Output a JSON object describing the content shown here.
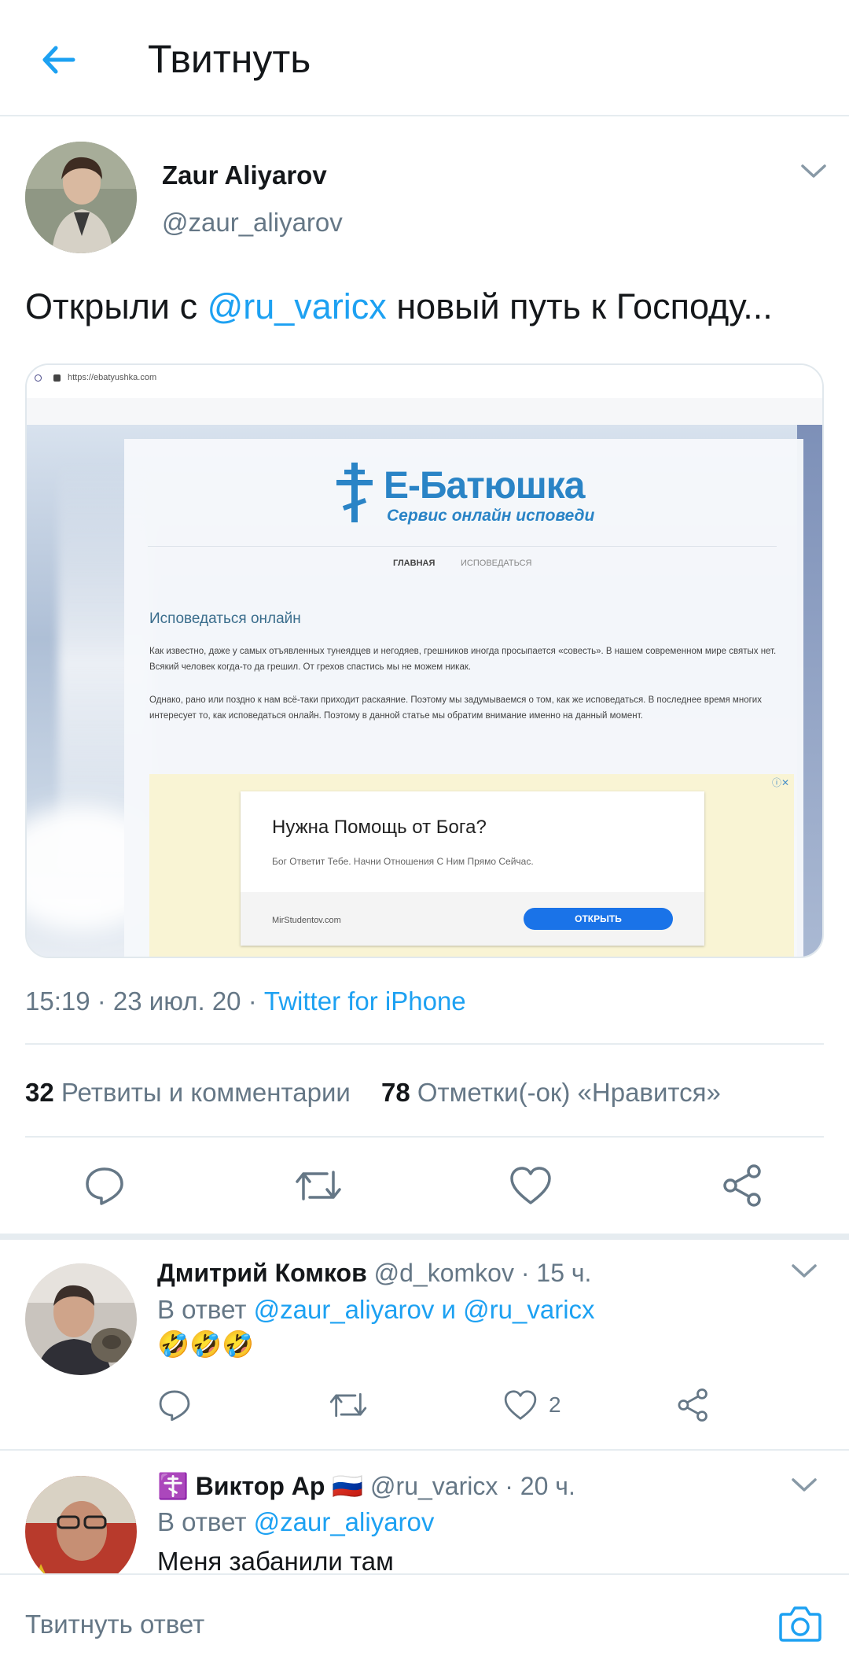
{
  "header": {
    "title": "Твитнуть"
  },
  "tweet": {
    "author_name": "Zaur Aliyarov",
    "author_handle": "@zaur_aliyarov",
    "text_before": "Открыли с ",
    "mention": "@ru_varicx",
    "text_after": " новый путь к Господу...",
    "time": "15:19 · 23 июл. 20 · ",
    "source": "Twitter for iPhone",
    "retweets_count": "32",
    "retweets_label": "Ретвиты и комментарии",
    "likes_count": "78",
    "likes_label": "Отметки(-ок) «Нравится»"
  },
  "media": {
    "url": "https://ebatyushka.com",
    "site_name": "Е-Батюшка",
    "site_tagline": "Сервис онлайн исповеди",
    "nav_1": "ГЛАВНАЯ",
    "nav_2": "ИСПОВЕДАТЬСЯ",
    "heading": "Исповедаться онлайн",
    "para_1": "Как известно, даже у самых отъявленных тунеядцев и негодяев, грешников иногда просыпается «совесть». В нашем современном мире святых нет. Всякий человек когда-то да грешил. От грехов спастись мы не можем никак.",
    "para_2": "Однако, рано или поздно к нам всё-таки приходит раскаяние. Поэтому мы задумываемся о том, как же исповедаться. В последнее время многих интересует то, как исповедаться онлайн. Поэтому в данной статье мы обратим внимание именно на данный момент.",
    "ad_title": "Нужна Помощь от Бога?",
    "ad_sub": "Бог Ответит Тебе. Начни Отношения С Ним Прямо Сейчас.",
    "ad_domain": "MirStudentov.com",
    "ad_button": "ОТКРЫТЬ",
    "ad_close": "ⓘ✕"
  },
  "replies": [
    {
      "name": "Дмитрий Комков",
      "handle": "@d_komkov · 15 ч.",
      "reply_prefix": "В ответ ",
      "reply_to": "@zaur_aliyarov и @ru_varicx",
      "text": "🤣🤣🤣",
      "likes": "2"
    },
    {
      "name_prefix": "☦️ ",
      "name": "Виктор Ар",
      "flag": "🇷🇺",
      "handle": "@ru_varicx · 20 ч.",
      "reply_prefix": "В ответ ",
      "reply_to": "@zaur_aliyarov",
      "text": "Меня забанили там"
    }
  ],
  "composer": {
    "placeholder": "Твитнуть ответ"
  },
  "colors": {
    "accent": "#1da1f2",
    "muted": "#657786",
    "text": "#14171a",
    "divider": "#e6ecf0"
  },
  "icons": [
    "back-arrow-icon",
    "chevron-down-icon",
    "reply-icon",
    "retweet-icon",
    "like-icon",
    "share-icon",
    "camera-icon",
    "cross-icon"
  ]
}
